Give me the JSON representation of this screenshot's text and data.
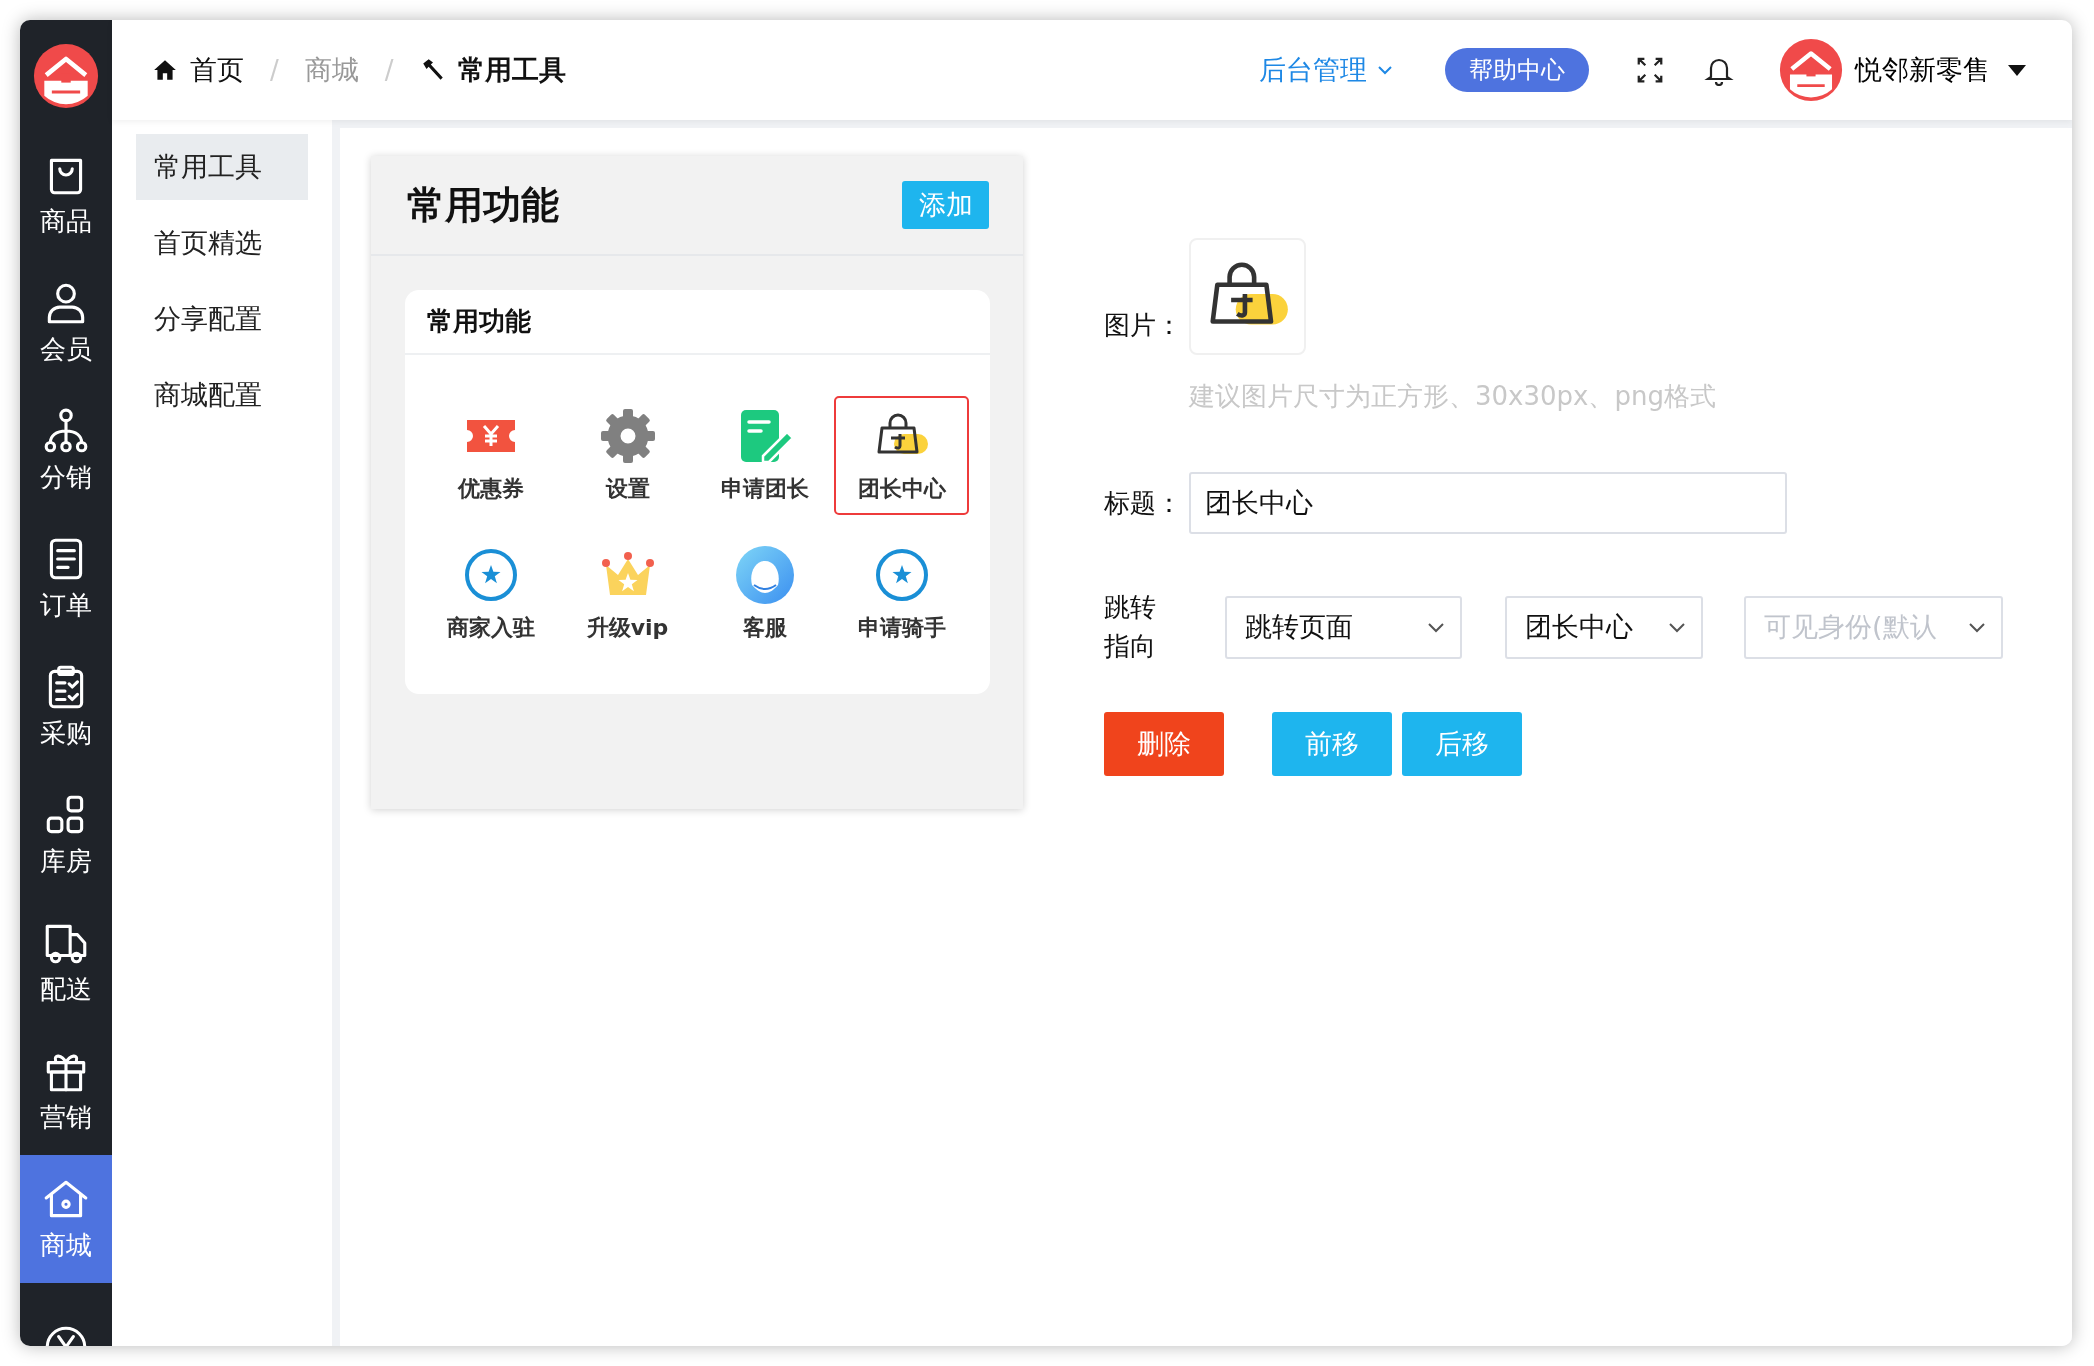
{
  "nav": [
    {
      "label": "商品",
      "selected": false
    },
    {
      "label": "会员",
      "selected": false
    },
    {
      "label": "分销",
      "selected": false
    },
    {
      "label": "订单",
      "selected": false
    },
    {
      "label": "采购",
      "selected": false
    },
    {
      "label": "库房",
      "selected": false
    },
    {
      "label": "配送",
      "selected": false
    },
    {
      "label": "营销",
      "selected": false
    },
    {
      "label": "商城",
      "selected": true
    },
    {
      "selected": false
    }
  ],
  "breadcrumb": [
    {
      "kind": "home",
      "text": "首页"
    },
    {
      "kind": "link",
      "separator": "/",
      "text": "商城"
    },
    {
      "kind": "current",
      "separator": "/",
      "text": "常用工具"
    }
  ],
  "header": {
    "admin_menu": "后台管理",
    "help_button": "帮助中心",
    "user": {
      "name": "悦邻新零售"
    }
  },
  "subnav": [
    {
      "label": "常用工具",
      "selected": true
    },
    {
      "label": "首页精选",
      "selected": false
    },
    {
      "label": "分享配置",
      "selected": false
    },
    {
      "label": "商城配置",
      "selected": false
    }
  ],
  "preview": {
    "title": "常用功能",
    "add_button": "添加",
    "section_title": "常用功能",
    "items": [
      {
        "label": "优惠券",
        "selected": false
      },
      {
        "label": "设置",
        "selected": false
      },
      {
        "label": "申请团长",
        "selected": false
      },
      {
        "label": "团长中心",
        "selected": true
      },
      {
        "label": "商家入驻",
        "selected": false
      },
      {
        "label": "升级vip",
        "selected": false
      },
      {
        "label": "客服",
        "selected": false
      },
      {
        "label": "申请骑手",
        "selected": false
      }
    ]
  },
  "form": {
    "image_label": "图片：",
    "image_hint": "建议图片尺寸为正方形、30x30px、png格式",
    "title_label": "标题：",
    "title_value": "团长中心",
    "jump_label": "跳转指向",
    "selects": [
      {
        "value": "跳转页面"
      },
      {
        "value": "团长中心"
      },
      {
        "placeholder": "可见身份(默认"
      }
    ],
    "buttons": [
      {
        "label": "删除",
        "kind": "danger"
      },
      {
        "label": "前移",
        "kind": "info"
      },
      {
        "label": "后移",
        "kind": "info"
      }
    ]
  }
}
